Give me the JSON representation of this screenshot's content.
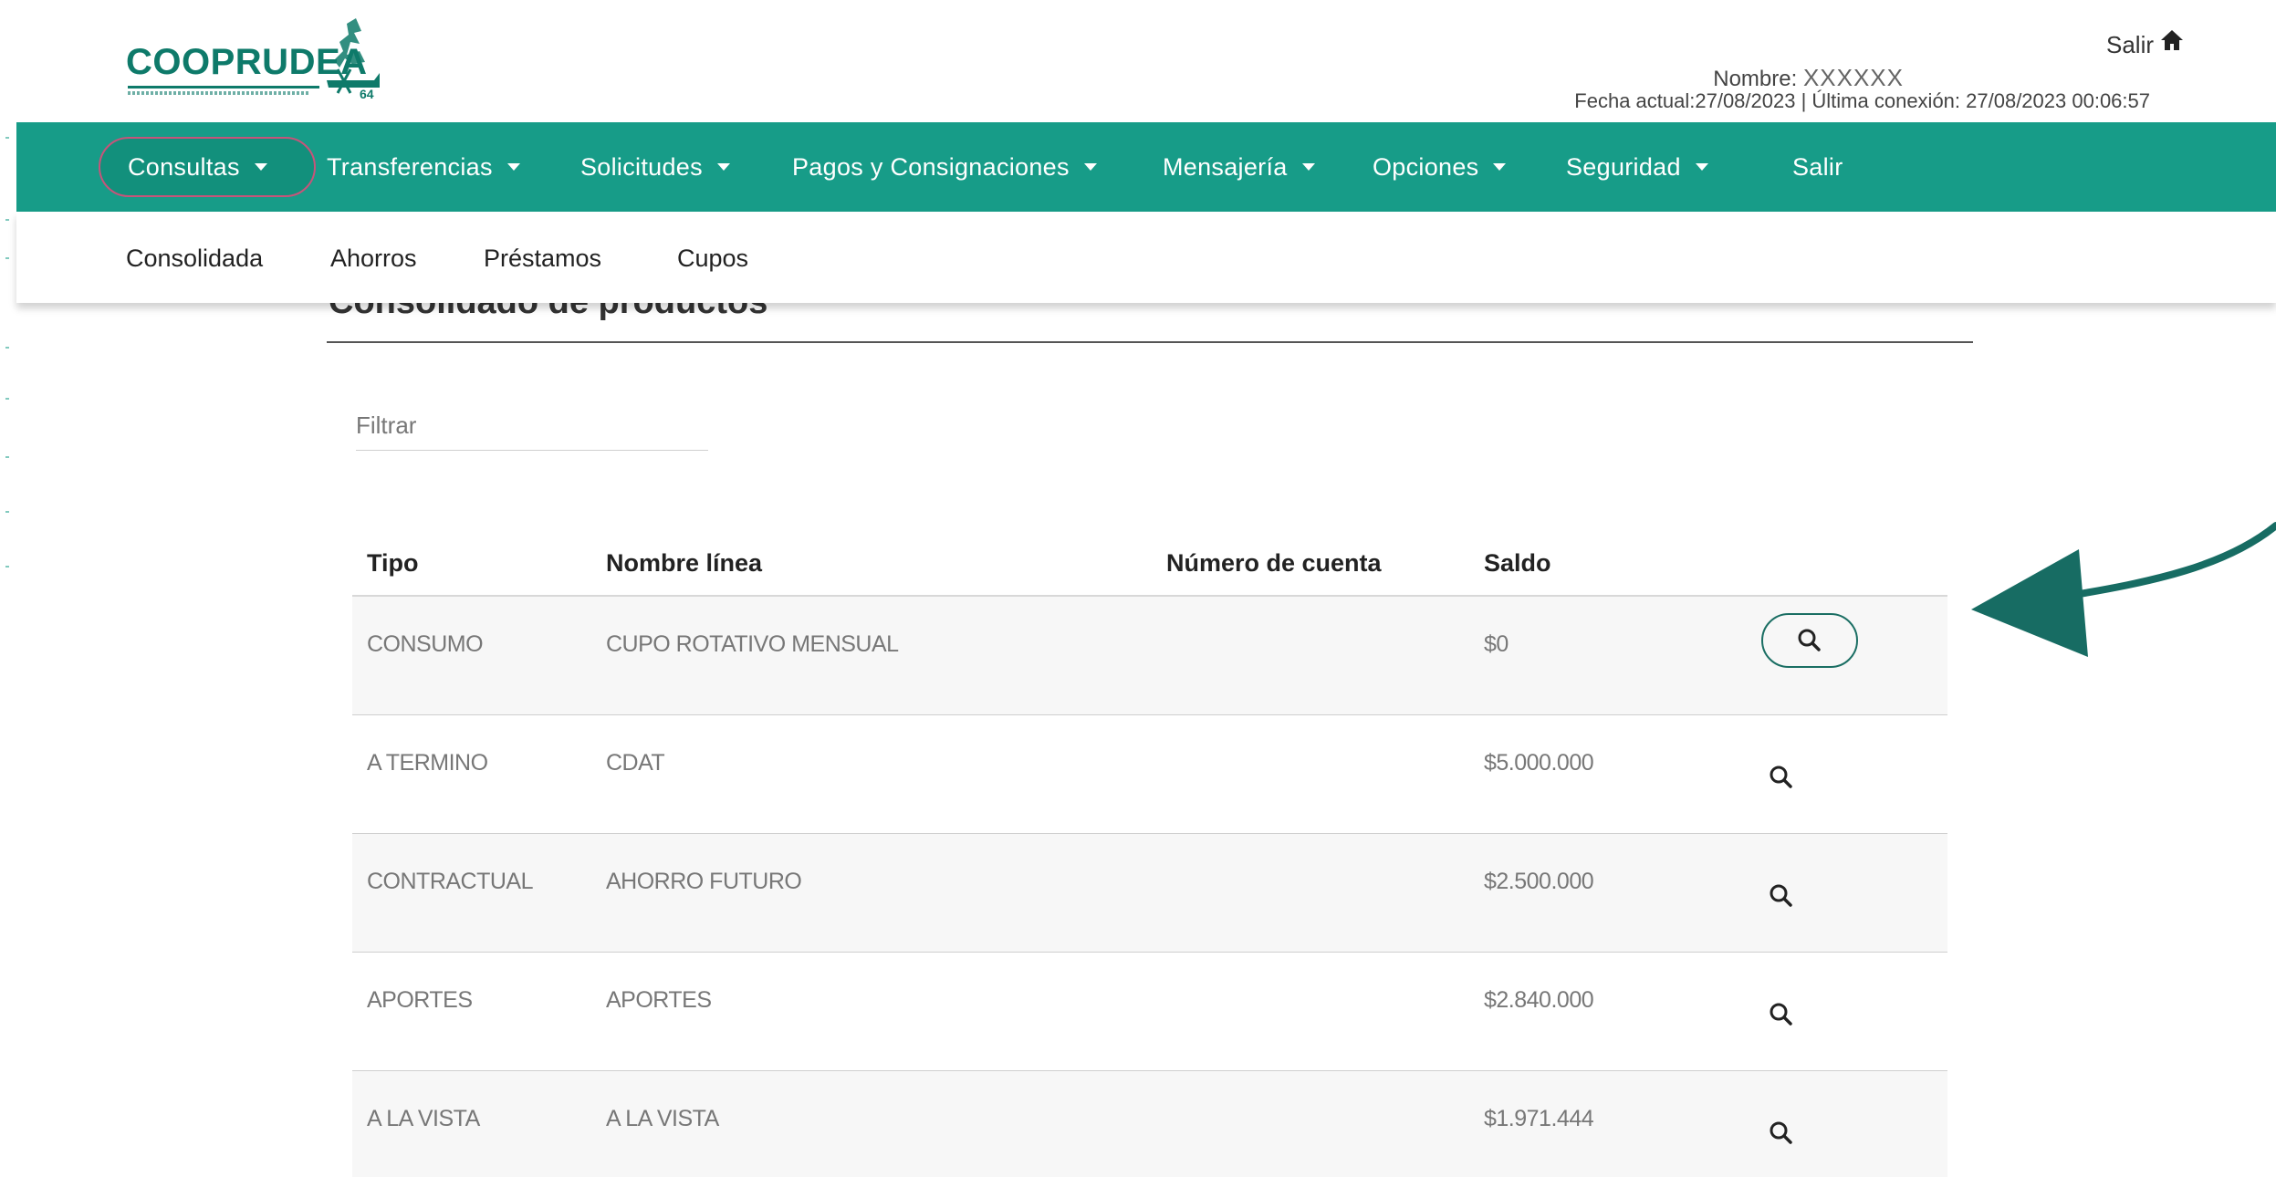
{
  "header": {
    "logo_text": "COOPRUDEA",
    "logout_label": "Salir",
    "user_label": "Nombre:",
    "user_value": "XXXXXX",
    "date_line": "Fecha actual:27/08/2023 | Última conexión: 27/08/2023 00:06:57"
  },
  "nav": {
    "items": [
      {
        "label": "Consultas"
      },
      {
        "label": "Transferencias"
      },
      {
        "label": "Solicitudes"
      },
      {
        "label": "Pagos y Consignaciones"
      },
      {
        "label": "Mensajería"
      },
      {
        "label": "Opciones"
      },
      {
        "label": "Seguridad"
      },
      {
        "label": "Salir"
      }
    ]
  },
  "subnav": {
    "items": [
      {
        "label": "Consolidada"
      },
      {
        "label": "Ahorros"
      },
      {
        "label": "Préstamos"
      },
      {
        "label": "Cupos"
      }
    ]
  },
  "page": {
    "title": "Consolidado de productos",
    "filter_placeholder": "Filtrar"
  },
  "table": {
    "headers": {
      "tipo": "Tipo",
      "nombre": "Nombre línea",
      "numero": "Número de cuenta",
      "saldo": "Saldo"
    },
    "rows": [
      {
        "tipo": "CONSUMO",
        "nombre": "CUPO ROTATIVO MENSUAL",
        "numero": "",
        "saldo": "$0"
      },
      {
        "tipo": "A TERMINO",
        "nombre": "CDAT",
        "numero": "",
        "saldo": "$5.000.000"
      },
      {
        "tipo": "CONTRACTUAL",
        "nombre": "AHORRO FUTURO",
        "numero": "",
        "saldo": "$2.500.000"
      },
      {
        "tipo": "APORTES",
        "nombre": "APORTES",
        "numero": "",
        "saldo": "$2.840.000"
      },
      {
        "tipo": "A LA VISTA",
        "nombre": "A LA VISTA",
        "numero": "",
        "saldo": "$1.971.444"
      }
    ]
  },
  "colors": {
    "brand": "#179c88",
    "brand_dark": "#0e7a6a",
    "active_outline": "#c7547a",
    "arrow": "#176c63"
  }
}
